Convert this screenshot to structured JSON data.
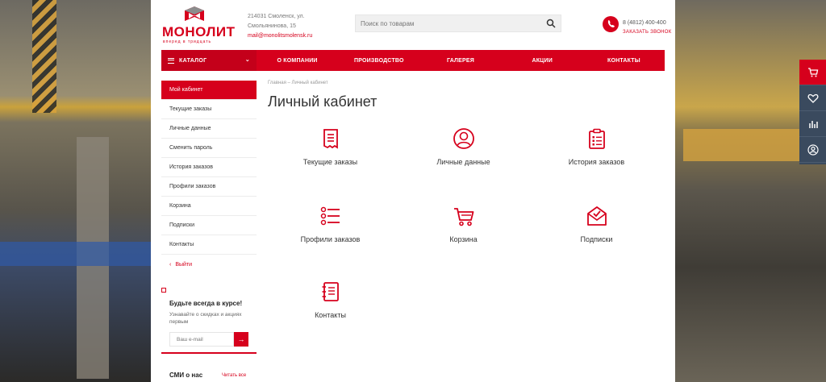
{
  "header": {
    "logo_text": "МОНОЛИТ",
    "logo_sub": "вперед в тридцать",
    "address_line1": "214031 Смоленск, ул.",
    "address_line2": "Смольянинова, 15",
    "email": "mail@monolitsmolensk.ru",
    "search_placeholder": "Поиск по товарам",
    "phone": "8 (4812) 400-400",
    "callback": "ЗАКАЗАТЬ ЗВОНОК"
  },
  "nav": {
    "catalog": "КАТАЛОГ",
    "items": [
      "О КОМПАНИИ",
      "ПРОИЗВОДСТВО",
      "ГАЛЕРЕЯ",
      "АКЦИИ",
      "КОНТАКТЫ"
    ]
  },
  "sidebar": {
    "items": [
      "Мой кабинет",
      "Текущие заказы",
      "Личные данные",
      "Сменить пароль",
      "История заказов",
      "Профили заказов",
      "Корзина",
      "Подписки",
      "Контакты"
    ],
    "exit": "Выйти"
  },
  "subscribe": {
    "title": "Будьте всегда в курсе!",
    "text": "Узнавайте о скидках и акциях первым",
    "placeholder": "Ваш e-mail",
    "button": "→"
  },
  "media": {
    "title": "СМИ о нас",
    "all": "Читать все"
  },
  "main": {
    "breadcrumbs": "Главная  –  Личный кабинет",
    "title": "Личный кабинет",
    "tiles": [
      {
        "label": "Текущие заказы",
        "icon": "receipt-icon"
      },
      {
        "label": "Личные данные",
        "icon": "user-icon"
      },
      {
        "label": "История заказов",
        "icon": "clipboard-icon"
      },
      {
        "label": "Профили заказов",
        "icon": "list-icon"
      },
      {
        "label": "Корзина",
        "icon": "cart-icon"
      },
      {
        "label": "Подписки",
        "icon": "envelope-icon"
      },
      {
        "label": "Контакты",
        "icon": "notebook-icon"
      }
    ]
  },
  "colors": {
    "accent": "#d6001c",
    "panel": "#3a4a5e"
  }
}
